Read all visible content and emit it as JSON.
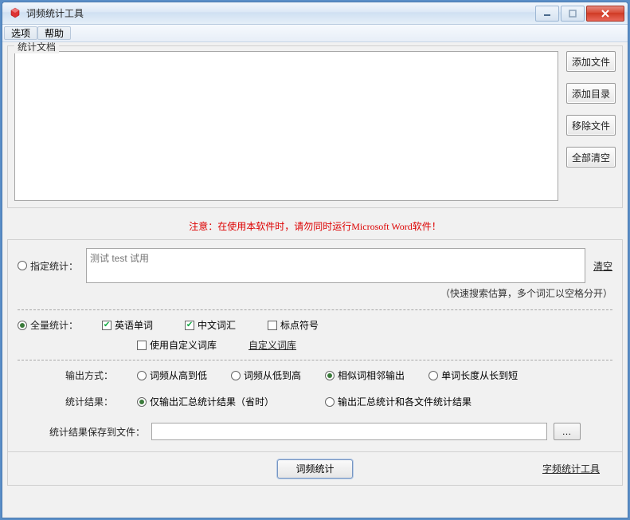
{
  "window": {
    "title": "词频统计工具"
  },
  "menus": {
    "options": "选项",
    "help": "帮助"
  },
  "fileset": {
    "legend": "统计文档",
    "add_file": "添加文件",
    "add_dir": "添加目录",
    "remove_file": "移除文件",
    "clear_all": "全部清空"
  },
  "warning": "注意：在使用本软件时，请勿同时运行Microsoft Word软件！",
  "spec": {
    "label": "指定统计：",
    "placeholder": "测试 test 试用",
    "clear_link": "清空",
    "hint": "（快速搜索估算，多个词汇以空格分开）"
  },
  "full": {
    "label": "全量统计：",
    "english": "英语单词",
    "chinese": "中文词汇",
    "punct": "标点符号",
    "custom_dict": "使用自定义词库",
    "dict_link": "自定义词库"
  },
  "output": {
    "mode_label": "输出方式：",
    "high_to_low": "词频从高到低",
    "low_to_high": "词频从低到高",
    "similar_adjacent": "相似词相邻输出",
    "len_long_to_short": "单词长度从长到短",
    "result_label": "统计结果：",
    "summary_only": "仅输出汇总统计结果（省时）",
    "summary_and_each": "输出汇总统计和各文件统计结果",
    "save_label": "统计结果保存到文件：",
    "browse": "…"
  },
  "actions": {
    "run": "词频统计",
    "char_tool": "字频统计工具"
  }
}
